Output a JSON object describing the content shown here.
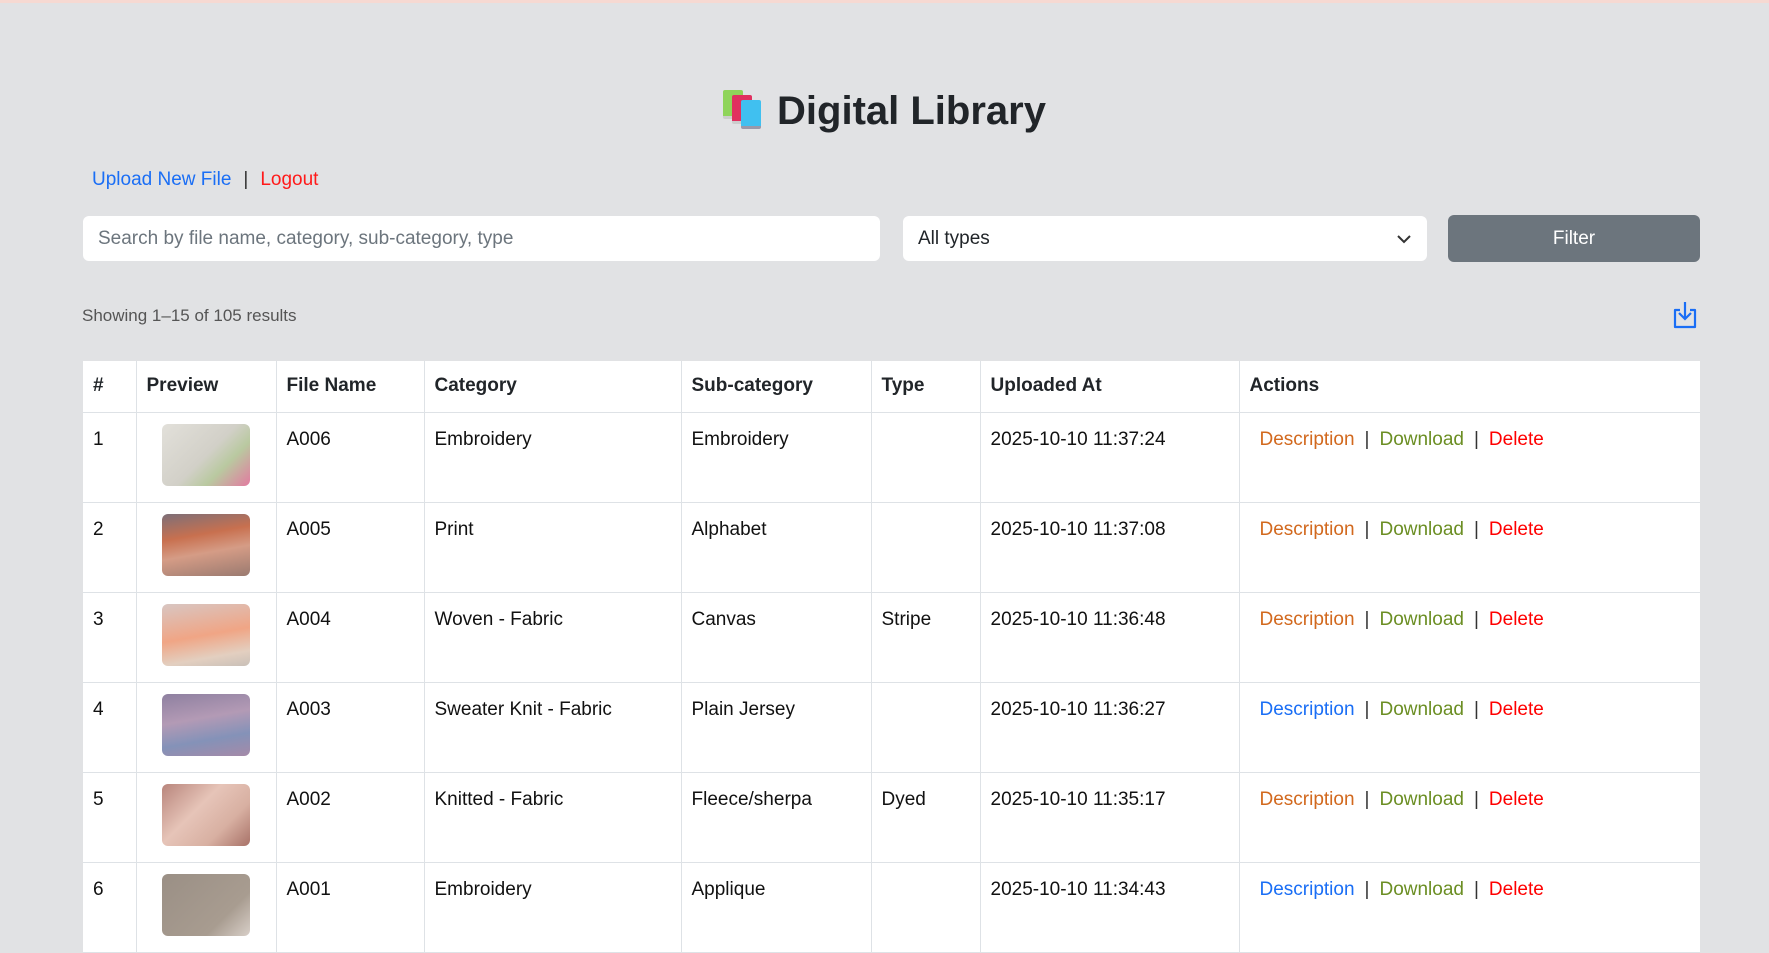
{
  "header": {
    "title": "Digital Library",
    "icon": "books-icon"
  },
  "links": {
    "upload": "Upload New File",
    "separator": "|",
    "logout": "Logout"
  },
  "filters": {
    "search_placeholder": "Search by file name, category, sub-category, type",
    "search_value": "",
    "type_selected": "All types",
    "filter_button": "Filter"
  },
  "summary": "Showing 1–15 of 105 results",
  "colors": {
    "link_blue": "#1a6ef5",
    "logout_red": "#ff1a1a",
    "desc_orange": "#d2691e",
    "download_olive": "#6b8e23",
    "delete_red": "#ff0000"
  },
  "table": {
    "headers": [
      "#",
      "Preview",
      "File Name",
      "Category",
      "Sub-category",
      "Type",
      "Uploaded At",
      "Actions"
    ],
    "actions": {
      "description": "Description",
      "download": "Download",
      "delete": "Delete",
      "sep": "|"
    },
    "rows": [
      {
        "n": "1",
        "file": "A006",
        "category": "Embroidery",
        "sub": "Embroidery",
        "type": "",
        "uploaded": "2025-10-10 11:37:24",
        "desc_color": "#d2691e",
        "thumb": "linear-gradient(135deg,#e2e0da,#d2d0c8 50%,#b9c9a0 70%,#e27aa0)"
      },
      {
        "n": "2",
        "file": "A005",
        "category": "Print",
        "sub": "Alphabet",
        "type": "",
        "uploaded": "2025-10-10 11:37:08",
        "desc_color": "#d2691e",
        "thumb": "linear-gradient(170deg,#7d6f78,#c8704f 35%,#d59c86 60%,#9a7a70)"
      },
      {
        "n": "3",
        "file": "A004",
        "category": "Woven - Fabric",
        "sub": "Canvas",
        "type": "Stripe",
        "uploaded": "2025-10-10 11:36:48",
        "desc_color": "#d2691e",
        "thumb": "linear-gradient(170deg,#d8c6c2,#f0a585 50%,#e3cfc0 80%,#c9c0b8)"
      },
      {
        "n": "4",
        "file": "A003",
        "category": "Sweater Knit - Fabric",
        "sub": "Plain Jersey",
        "type": "",
        "uploaded": "2025-10-10 11:36:27",
        "desc_color": "#1a6ef5",
        "thumb": "linear-gradient(170deg,#8e80a0,#b39ab5 40%,#8492b8 70%,#a58aa8)"
      },
      {
        "n": "5",
        "file": "A002",
        "category": "Knitted - Fabric",
        "sub": "Fleece/sherpa",
        "type": "Dyed",
        "uploaded": "2025-10-10 11:35:17",
        "desc_color": "#d2691e",
        "thumb": "linear-gradient(135deg,#b8857c,#e6c4b8 40%,#d8b0a2 70%,#a87268)"
      },
      {
        "n": "6",
        "file": "A001",
        "category": "Embroidery",
        "sub": "Applique",
        "type": "",
        "uploaded": "2025-10-10 11:34:43",
        "desc_color": "#1a6ef5",
        "thumb": "linear-gradient(135deg,#9a8f85,#a89c90 70%,#d8cfc8)"
      }
    ]
  }
}
